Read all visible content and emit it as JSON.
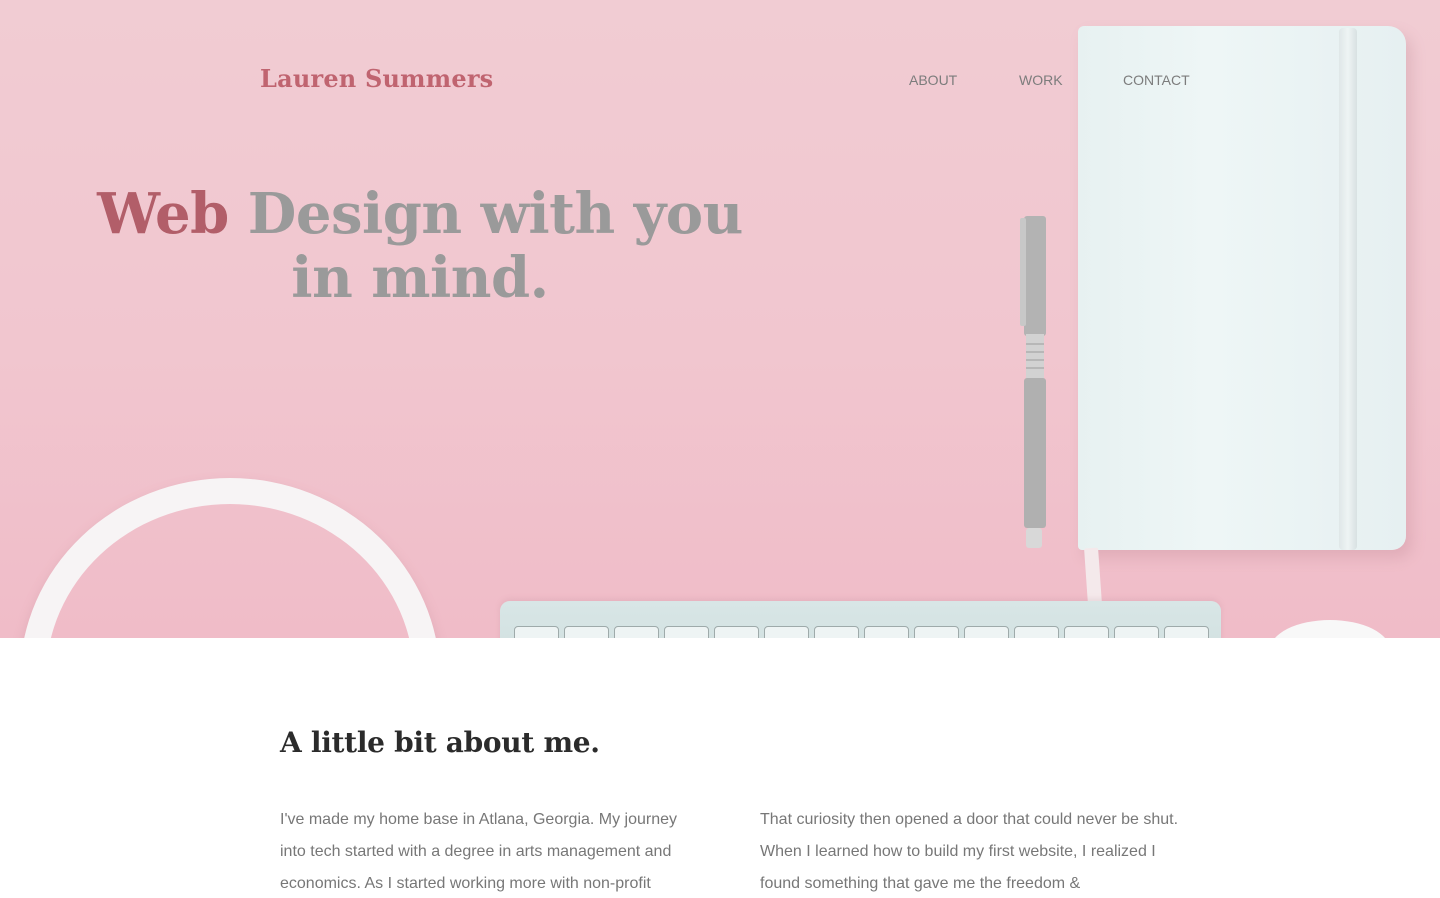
{
  "site": {
    "brand": "Lauren Summers"
  },
  "nav": {
    "items": [
      "ABOUT",
      "WORK",
      "CONTACT"
    ]
  },
  "hero": {
    "headline_accent": "Web",
    "headline_rest": "Design with you in mind."
  },
  "about": {
    "title": "A little bit about me.",
    "paragraph_left": "I've made my home base in Atlana, Georgia. My journey into tech started with a degree in arts management and economics. As I started working more with non-profit",
    "paragraph_right": "That curiosity then opened a door that could never be shut. When I learned how to build my first website, I realized I found something that gave me the freedom &"
  },
  "decor": {
    "icons": [
      "headphones-image",
      "keyboard-image",
      "pen-image",
      "notebook-image",
      "mouse-image"
    ]
  },
  "colors": {
    "hero_background": "#f1c6cf",
    "brand_accent": "#c06470",
    "headline_gray": "#9a9a9a",
    "body_text": "#777777",
    "heading_dark": "#2b2b2b"
  }
}
